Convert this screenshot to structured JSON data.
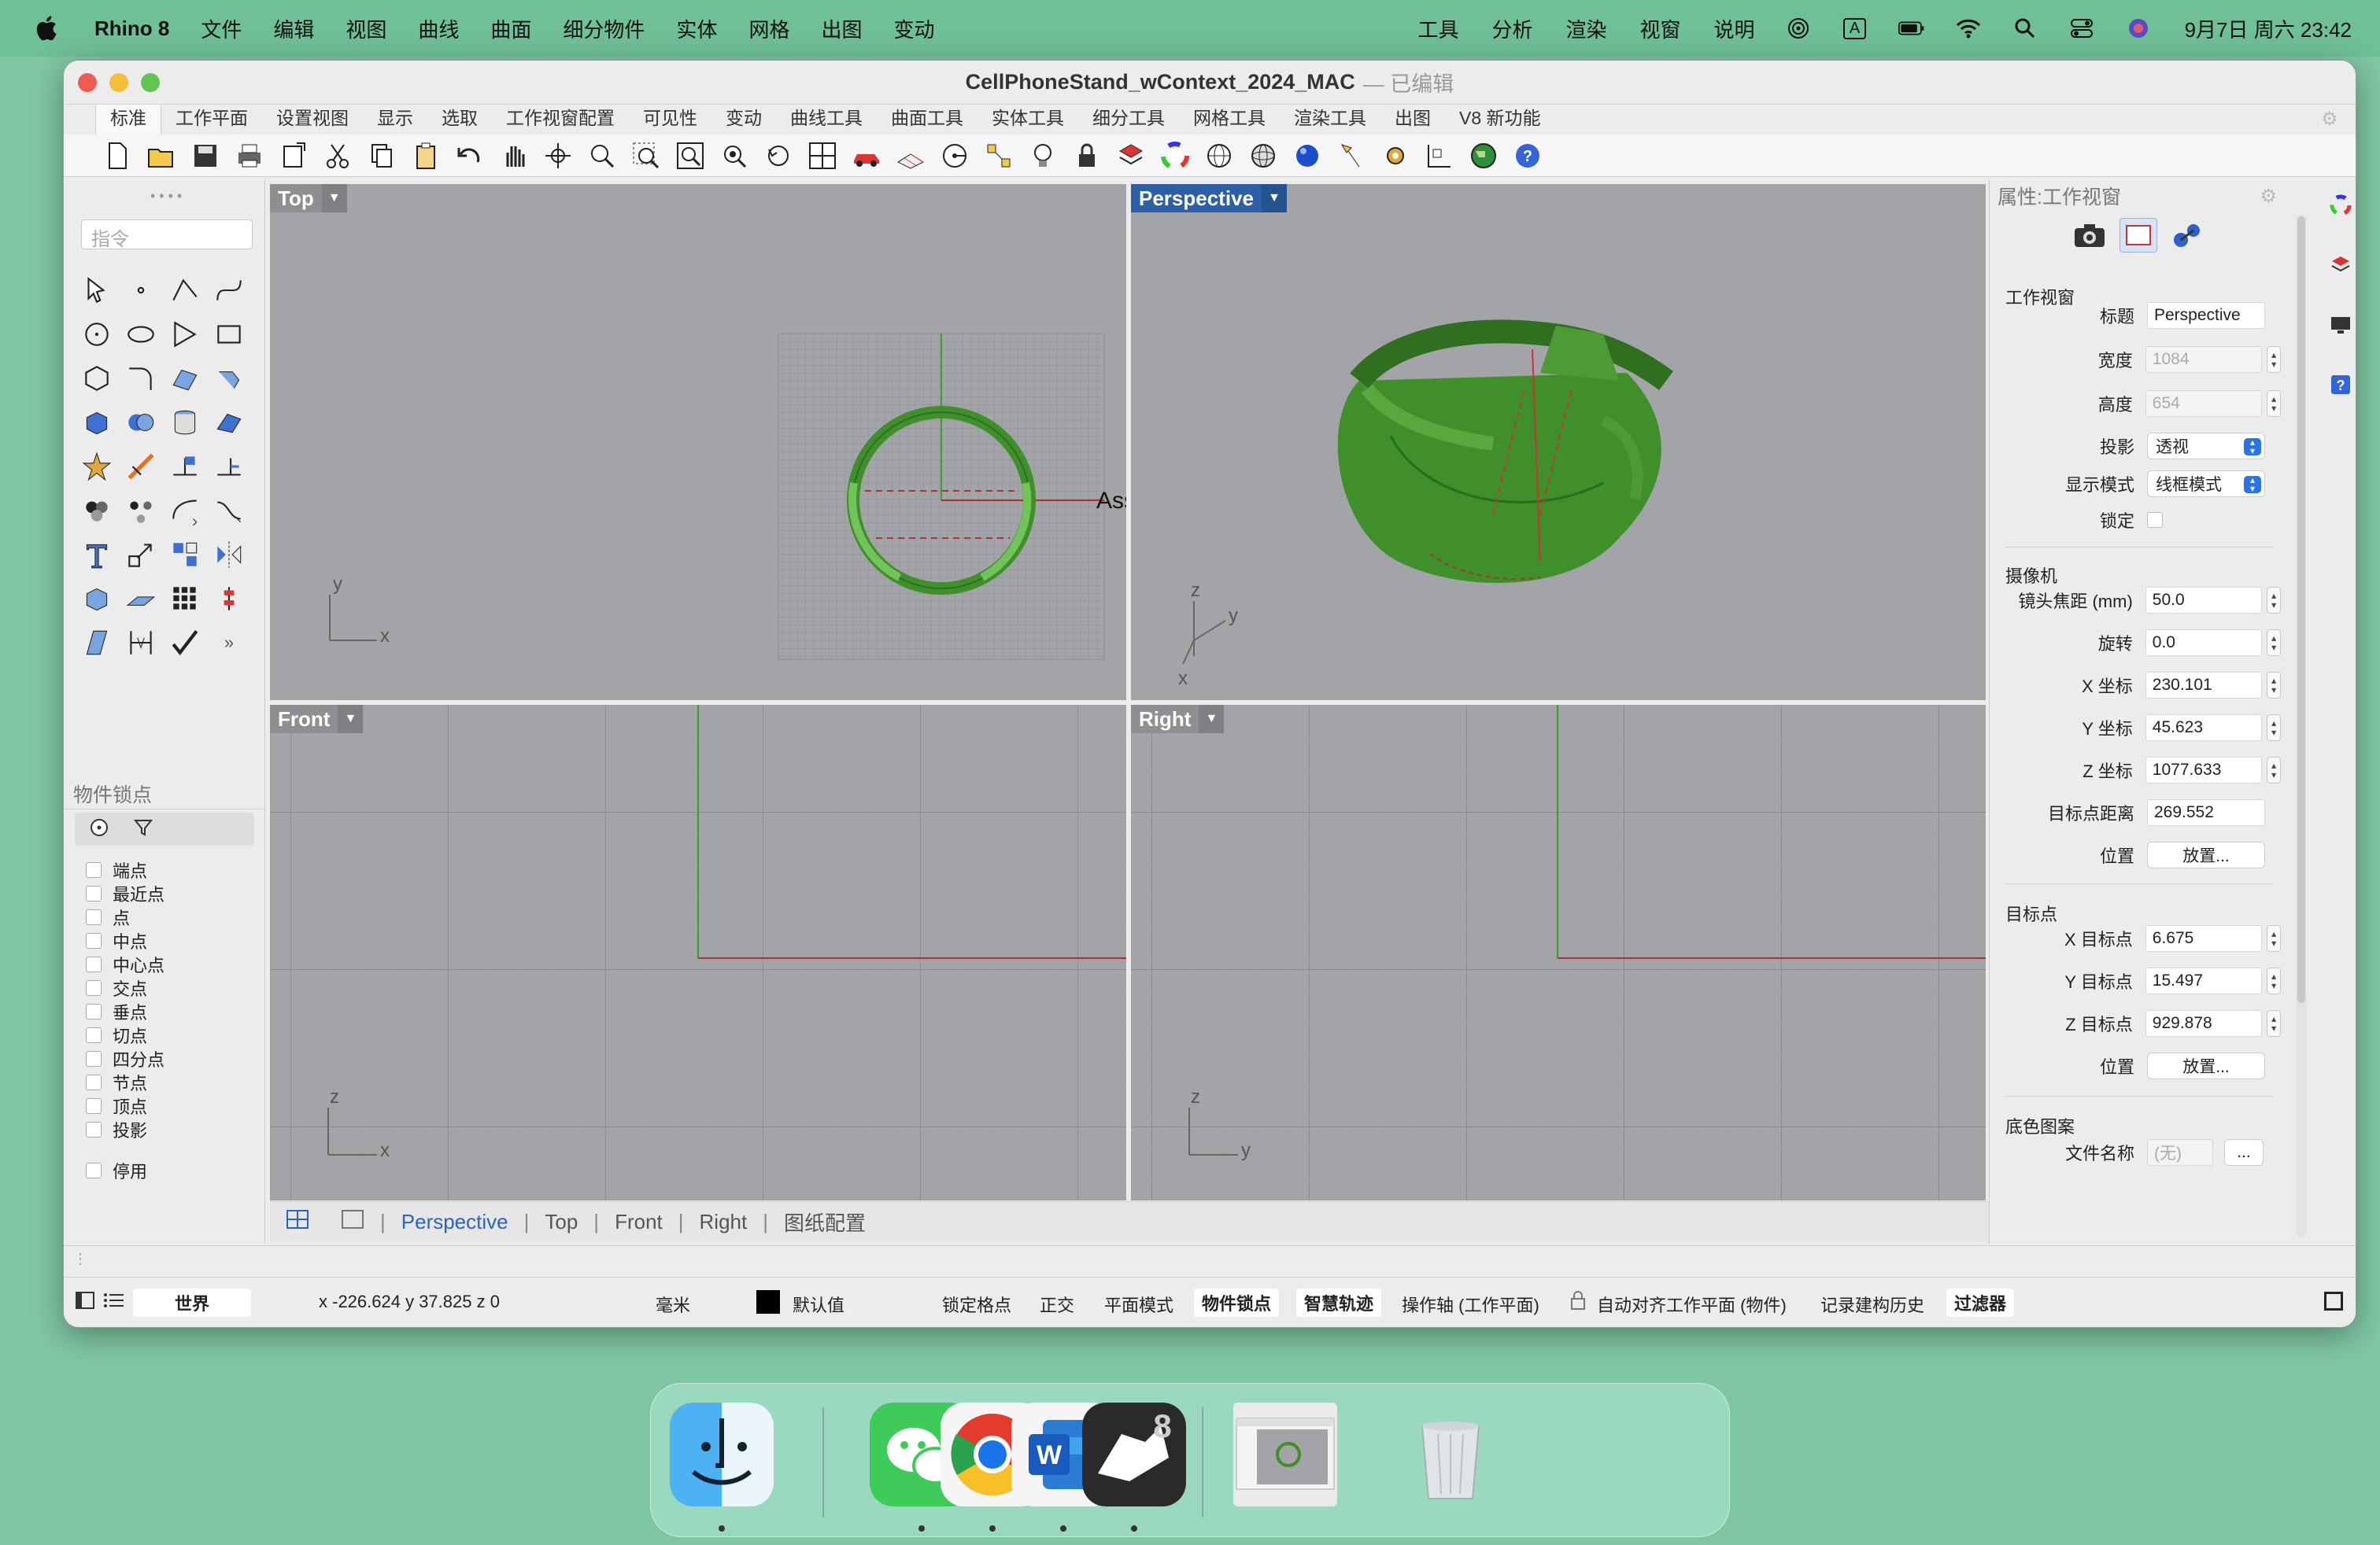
{
  "menubar": {
    "app_name": "Rhino 8",
    "items": [
      "文件",
      "编辑",
      "视图",
      "曲线",
      "曲面",
      "细分物件",
      "实体",
      "网格",
      "出图",
      "变动"
    ],
    "right_items": [
      "工具",
      "分析",
      "渲染",
      "视窗",
      "说明"
    ],
    "input_method": "A",
    "datetime": "9月7日 周六 23:42"
  },
  "window": {
    "title": "CellPhoneStand_wContext_2024_MAC",
    "subtitle": "— 已编辑"
  },
  "tabs": [
    "标准",
    "工作平面",
    "设置视图",
    "显示",
    "选取",
    "工作视窗配置",
    "可见性",
    "变动",
    "曲线工具",
    "曲面工具",
    "实体工具",
    "细分工具",
    "网格工具",
    "渲染工具",
    "出图",
    "V8 新功能"
  ],
  "command": {
    "placeholder": "指令"
  },
  "osnap": {
    "title": "物件锁点",
    "items": [
      "端点",
      "最近点",
      "点",
      "中点",
      "中心点",
      "交点",
      "垂点",
      "切点",
      "四分点",
      "节点",
      "顶点",
      "投影"
    ],
    "disable": "停用"
  },
  "viewports": {
    "top": {
      "name": "Top",
      "axis_a": "y",
      "axis_b": "x",
      "overlay_text": "Ass"
    },
    "perspective": {
      "name": "Perspective",
      "axis_a": "z",
      "axis_b": "y",
      "axis_c": "x"
    },
    "front": {
      "name": "Front",
      "axis_a": "z",
      "axis_b": "x"
    },
    "right": {
      "name": "Right",
      "axis_a": "z",
      "axis_b": "y"
    }
  },
  "viewport_tabs": [
    "Perspective",
    "Top",
    "Front",
    "Right",
    "图纸配置"
  ],
  "properties": {
    "header": "属性:工作视窗",
    "section_viewport": "工作视窗",
    "title_label": "标题",
    "title_value": "Perspective",
    "width_label": "宽度",
    "width_value": "1084",
    "height_label": "高度",
    "height_value": "654",
    "projection_label": "投影",
    "projection_value": "透视",
    "display_label": "显示模式",
    "display_value": "线框模式",
    "lock_label": "锁定",
    "section_camera": "摄像机",
    "focal_label": "镜头焦距 (mm)",
    "focal_value": "50.0",
    "rotate_label": "旋转",
    "rotate_value": "0.0",
    "cx_label": "X 坐标",
    "cx_value": "230.101",
    "cy_label": "Y 坐标",
    "cy_value": "45.623",
    "cz_label": "Z 坐标",
    "cz_value": "1077.633",
    "dist_label": "目标点距离",
    "dist_value": "269.552",
    "pos_label": "位置",
    "place_button": "放置...",
    "section_target": "目标点",
    "tx_label": "X 目标点",
    "tx_value": "6.675",
    "ty_label": "Y 目标点",
    "ty_value": "15.497",
    "tz_label": "Z 目标点",
    "tz_value": "929.878",
    "tpos_label": "位置",
    "tplace_button": "放置...",
    "section_bg": "底色图案",
    "file_label": "文件名称",
    "file_value": "(无)",
    "file_button": "..."
  },
  "status": {
    "world": "世界",
    "coords": "x -226.624  y 37.825  z 0",
    "units": "毫米",
    "layer": "默认值",
    "grid_snap": "锁定格点",
    "ortho": "正交",
    "planar": "平面模式",
    "osnap": "物件锁点",
    "smart_track": "智慧轨迹",
    "gumball": "操作轴 (工作平面)",
    "auto_align": "自动对齐工作平面 (物件)",
    "history": "记录建构历史",
    "filter": "过滤器"
  },
  "colors": {
    "accent": "#2d5fa6",
    "object_green": "#3f8f2a",
    "viewport_bg": "#a2a4a7",
    "desktop": "#7fc7a3"
  }
}
